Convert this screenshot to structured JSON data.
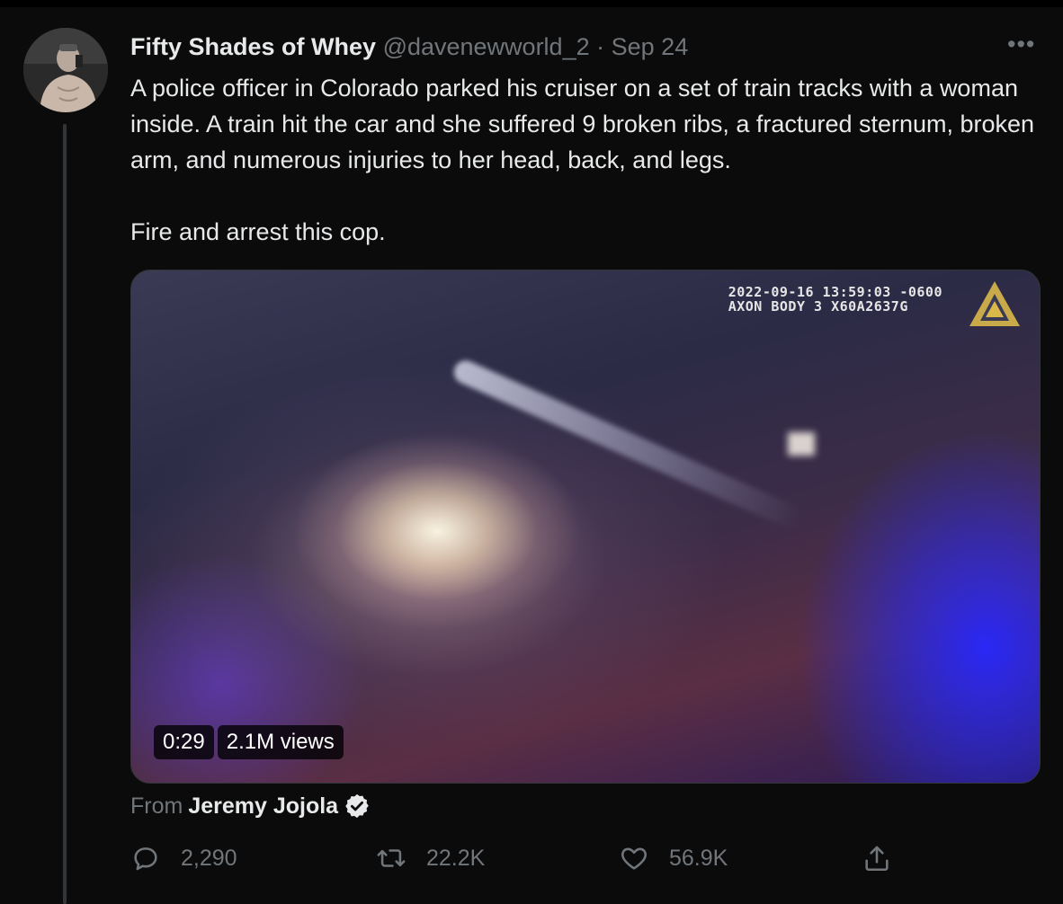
{
  "tweet": {
    "display_name": "Fifty Shades of Whey",
    "handle": "@davenewworld_2",
    "separator": "·",
    "date": "Sep 24",
    "more_label": "•••",
    "text_paragraphs": [
      "A police officer in Colorado parked his cruiser on a set of train tracks with a woman inside. A train hit the car and she suffered 9 broken ribs, a fractured sternum, broken arm, and numerous injuries to her head, back, and legs.",
      "Fire and arrest this cop."
    ],
    "avatar_icon": "person-avatar"
  },
  "media": {
    "watermark_line1": "2022-09-16 13:59:03 -0600",
    "watermark_line2": "AXON BODY 3 X60A2637G",
    "duration": "0:29",
    "views": "2.1M views",
    "logo_icon": "axon-logo-icon",
    "accent_color": "#d9b84a"
  },
  "attribution": {
    "from_label": "From",
    "source_name": "Jeremy Jojola",
    "verified_icon": "verified-badge-icon"
  },
  "actions": {
    "reply": {
      "icon": "reply-icon",
      "count": "2,290"
    },
    "retweet": {
      "icon": "retweet-icon",
      "count": "22.2K"
    },
    "like": {
      "icon": "heart-icon",
      "count": "56.9K"
    },
    "share": {
      "icon": "share-icon"
    }
  },
  "colors": {
    "background": "#000000",
    "text_primary": "#e7e9ea",
    "text_secondary": "#71767b",
    "thread_line": "#333639"
  }
}
